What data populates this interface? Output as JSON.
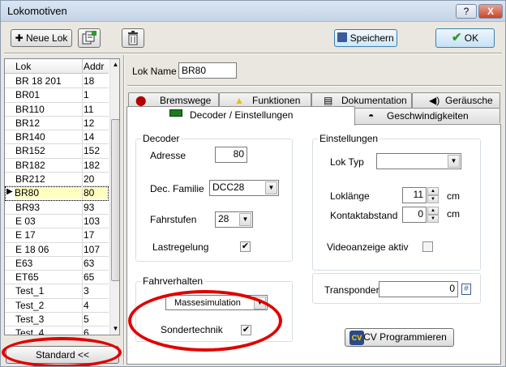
{
  "window": {
    "title": "Lokomotiven",
    "help_label": "?",
    "close_label": "X"
  },
  "toolbar": {
    "new_lok_label": "Neue Lok",
    "new_lok_icon": "plus-icon",
    "copy_icon": "copy-icon",
    "delete_icon": "trash-icon",
    "save_label": "Speichern",
    "ok_label": "OK"
  },
  "list": {
    "col_name": "Lok",
    "col_addr": "Addr",
    "rows": [
      {
        "name": "BR 18 201",
        "addr": "18"
      },
      {
        "name": "BR01",
        "addr": "1"
      },
      {
        "name": "BR110",
        "addr": "11"
      },
      {
        "name": "BR12",
        "addr": "12"
      },
      {
        "name": "BR140",
        "addr": "14"
      },
      {
        "name": "BR152",
        "addr": "152"
      },
      {
        "name": "BR182",
        "addr": "182"
      },
      {
        "name": "BR212",
        "addr": "20"
      },
      {
        "name": "BR80",
        "addr": "80"
      },
      {
        "name": "BR93",
        "addr": "93"
      },
      {
        "name": "E 03",
        "addr": "103"
      },
      {
        "name": "E 17",
        "addr": "17"
      },
      {
        "name": "E 18 06",
        "addr": "107"
      },
      {
        "name": "E63",
        "addr": "63"
      },
      {
        "name": "ET65",
        "addr": "65"
      },
      {
        "name": "Test_1",
        "addr": "3"
      },
      {
        "name": "Test_2",
        "addr": "4"
      },
      {
        "name": "Test_3",
        "addr": "5"
      },
      {
        "name": "Test_4",
        "addr": "6"
      }
    ],
    "selected_index": 8,
    "standard_label": "Standard <<"
  },
  "lok_name": {
    "label": "Lok Name",
    "value": "BR80"
  },
  "tabs": {
    "bremswege": "Bremswege",
    "funktionen": "Funktionen",
    "dokumentation": "Dokumentation",
    "geraeusche": "Geräusche",
    "decoder": "Decoder / Einstellungen",
    "geschwindigkeiten": "Geschwindigkeiten"
  },
  "decoder": {
    "group_label": "Decoder",
    "adresse_label": "Adresse",
    "adresse_value": "80",
    "familie_label": "Dec. Familie",
    "familie_value": "DCC28",
    "fahrstufen_label": "Fahrstufen",
    "fahrstufen_value": "28",
    "lastregelung_label": "Lastregelung",
    "lastregelung_checked": true
  },
  "fahrverhalten": {
    "group_label": "Fahrverhalten",
    "mode_value": "Massesimulation",
    "sondertechnik_label": "Sondertechnik",
    "sondertechnik_checked": true
  },
  "einstellungen": {
    "group_label": "Einstellungen",
    "loktyp_label": "Lok Typ",
    "loktyp_value": "",
    "loklaenge_label": "Loklänge",
    "loklaenge_value": "11",
    "loklaenge_unit": "cm",
    "kontaktabstand_label": "Kontaktabstand",
    "kontaktabstand_value": "0",
    "kontaktabstand_unit": "cm",
    "video_label": "Videoanzeige aktiv",
    "video_checked": false
  },
  "transponder": {
    "label": "Transponder",
    "value": "0",
    "icon_label": "#"
  },
  "cv_button": {
    "label": "CV Programmieren",
    "icon_label": "CV"
  },
  "checkmark": "✔"
}
